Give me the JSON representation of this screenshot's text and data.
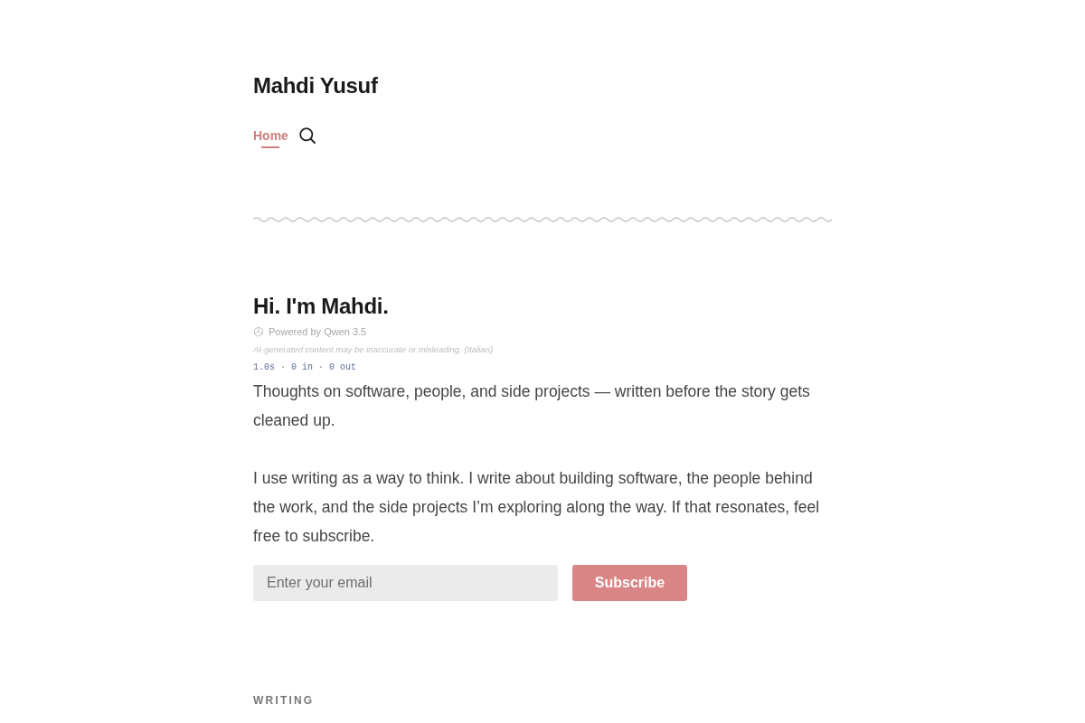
{
  "site": {
    "title": "Mahdi Yusuf"
  },
  "nav": {
    "items": [
      {
        "label": "Home",
        "selected": true
      }
    ]
  },
  "intro": {
    "heading": "Hi. I'm Mahdi.",
    "powered_by": "Powered by Qwen 3.5",
    "disclaimer": "AI-generated content may be inaccurate or misleading. (Italian)",
    "stats": "1.0s · 0 in · 0 out",
    "paragraphs": [
      "Thoughts on software, people, and side projects — written before the story gets cleaned up.",
      "I use writing as a way to think. I write about building software, the people behind the work, and the side projects I’m exploring along the way. If that resonates, feel free to subscribe."
    ]
  },
  "subscribe": {
    "placeholder": "Enter your email",
    "button": "Subscribe"
  },
  "section_heading": "WRITING"
}
